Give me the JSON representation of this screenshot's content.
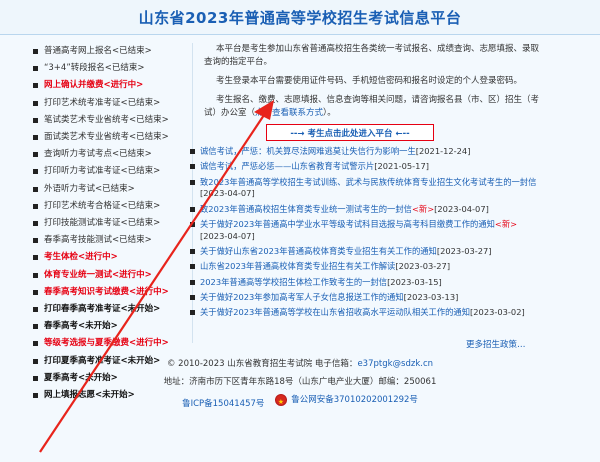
{
  "header": {
    "title": "山东省2023年普通高等学校招生考试信息平台"
  },
  "menu": [
    {
      "label": "普通高考网上报名<已结束>",
      "style": "normal"
    },
    {
      "label": "“3+4”转段报名<已结束>",
      "style": "normal"
    },
    {
      "label": "网上确认并缴费<进行中>",
      "style": "red"
    },
    {
      "label": "打印艺术统考准考证<已结束>",
      "style": "normal"
    },
    {
      "label": "笔试类艺术专业省统考<已结束>",
      "style": "normal"
    },
    {
      "label": "面试类艺术专业省统考<已结束>",
      "style": "normal"
    },
    {
      "label": "查询听力考试考点<已结束>",
      "style": "normal"
    },
    {
      "label": "打印听力考试准考证<已结束>",
      "style": "normal"
    },
    {
      "label": "外语听力考试<已结束>",
      "style": "normal"
    },
    {
      "label": "打印艺术统考合格证<已结束>",
      "style": "normal"
    },
    {
      "label": "打印技能测试准考证<已结束>",
      "style": "normal"
    },
    {
      "label": "春季高考技能测试<已结束>",
      "style": "normal"
    },
    {
      "label": "考生体检<进行中>",
      "style": "red"
    },
    {
      "label": "体育专业统一测试<进行中>",
      "style": "red"
    },
    {
      "label": "春季高考知识考试缴费<进行中>",
      "style": "red"
    },
    {
      "label": "打印春季高考准考证<未开始>",
      "style": "bold"
    },
    {
      "label": "春季高考<未开始>",
      "style": "bold"
    },
    {
      "label": "等级考选报与夏季缴费<进行中>",
      "style": "red"
    },
    {
      "label": "打印夏季高考准考证<未开始>",
      "style": "bold"
    },
    {
      "label": "夏季高考<未开始>",
      "style": "bold"
    },
    {
      "label": "网上填报志愿<未开始>",
      "style": "bold"
    }
  ],
  "notice": {
    "p1": "本平台是考生参加山东省普通高校招生各类统一考试报名、成绩查询、志愿填报、录取查询的指定平台。",
    "p2": "考生登录本平台需要使用证件号码、手机短信密码和报名时设定的个人登录密码。",
    "p3": "考生报名、缴费、志愿填报、信息查询等相关问题，请咨询报名县（市、区）招生（考试）办公室（",
    "p3_link": "点击查看联系方式",
    "p3_end": "）。"
  },
  "enter_button": "--→ 考生点击此处进入平台 ←--",
  "news": [
    {
      "title": "诚信考试，",
      "title2": "严惩：机关算尽法网难逃莫让失信行为影响一生",
      "date": "[2021-12-24]",
      "is_new": ""
    },
    {
      "title": "诚信考试，",
      "title2": "严惩必惩——山东省教育考试警示片",
      "date": "[2021-05-17]",
      "is_new": ""
    },
    {
      "title": "致2023年普通高等学校招生考试训练、武术与民族传统体育专业招生文化考试考生的一封信",
      "title2": "",
      "date": "[2023-04-07]",
      "is_new": ""
    },
    {
      "title": "致2023年普通高校招生体育类专业统一测试考生的一封信",
      "title2": "",
      "date": "[2023-04-07]",
      "is_new": "<新>"
    },
    {
      "title": "关于做好2023年普通高中学业水平等级考试科目选报与高考科目缴费工作的通知",
      "title2": "",
      "date": "[2023-04-07]",
      "is_new": "<新>"
    },
    {
      "title": "关于做好山东省2023年普通高校体育类专业招生有关工作的通知",
      "title2": "",
      "date": "[2023-03-27]",
      "is_new": ""
    },
    {
      "title": "山东省2023年普通高校体育类专业招生有关工作解读",
      "title2": "",
      "date": "[2023-03-27]",
      "is_new": ""
    },
    {
      "title": "2023年普通高等学校招生体检工作致考生的一封信",
      "title2": "",
      "date": "[2023-03-15]",
      "is_new": ""
    },
    {
      "title": "关于做好2023年参加高考军人子女信息报送工作的通知",
      "title2": "",
      "date": "[2023-03-13]",
      "is_new": ""
    },
    {
      "title": "关于做好2023年普通高等学校在山东省招收高水平运动队相关工作的通知",
      "title2": "",
      "date": "[2023-03-02]",
      "is_new": ""
    }
  ],
  "more": "更多招生政策…",
  "footer": {
    "copyright": "© 2010-2023 山东省教育招生考试院 电子信箱：",
    "email": "e37ptgk@sdzk.cn",
    "address": "地址：济南市历下区青年东路18号（山东广电产业大厦）邮编：250061",
    "icp": "鲁ICP备15041457号",
    "police": "鲁公网安备37010202001292号"
  },
  "colors": {
    "accent": "#1a5fb4",
    "alert": "#e60012",
    "annotation_arrow": "#e8241c"
  }
}
